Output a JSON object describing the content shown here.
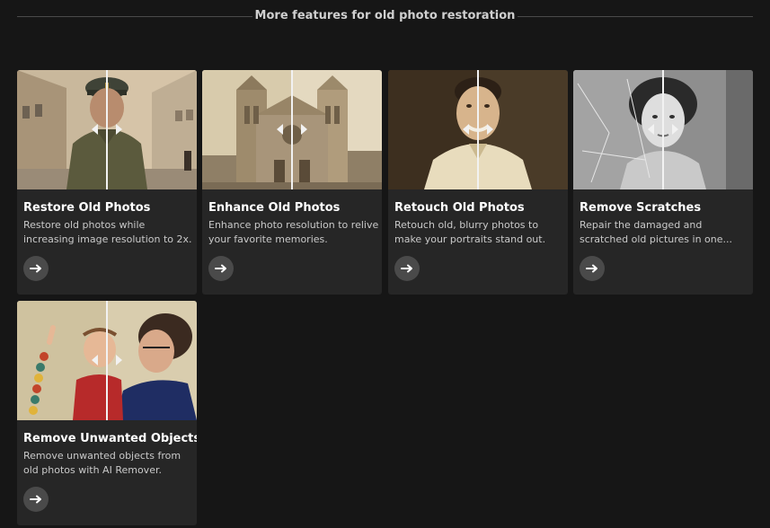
{
  "section": {
    "title": "More features for old photo restoration"
  },
  "cards": [
    {
      "title": "Restore Old Photos",
      "description": "Restore old photos while\nincreasing image resolution to 2x.",
      "button_icon": "arrow-right-icon"
    },
    {
      "title": "Enhance Old Photos",
      "description": "Enhance photo resolution to relive\nyour favorite memories.",
      "button_icon": "arrow-right-icon"
    },
    {
      "title": "Retouch Old Photos",
      "description": "Retouch old, blurry photos to\nmake your portraits stand out.",
      "button_icon": "arrow-right-icon"
    },
    {
      "title": "Remove Scratches",
      "description": "Repair the damaged and\nscratched old pictures in one...",
      "button_icon": "arrow-right-icon"
    },
    {
      "title": "Remove Unwanted Objects",
      "description": "Remove unwanted objects from\nold photos with AI Remover.",
      "button_icon": "arrow-right-icon"
    }
  ],
  "colors": {
    "background": "#161616",
    "card": "#262626",
    "button": "#4a4a4a",
    "text": "#ffffff",
    "muted": "#c9c9c9"
  }
}
